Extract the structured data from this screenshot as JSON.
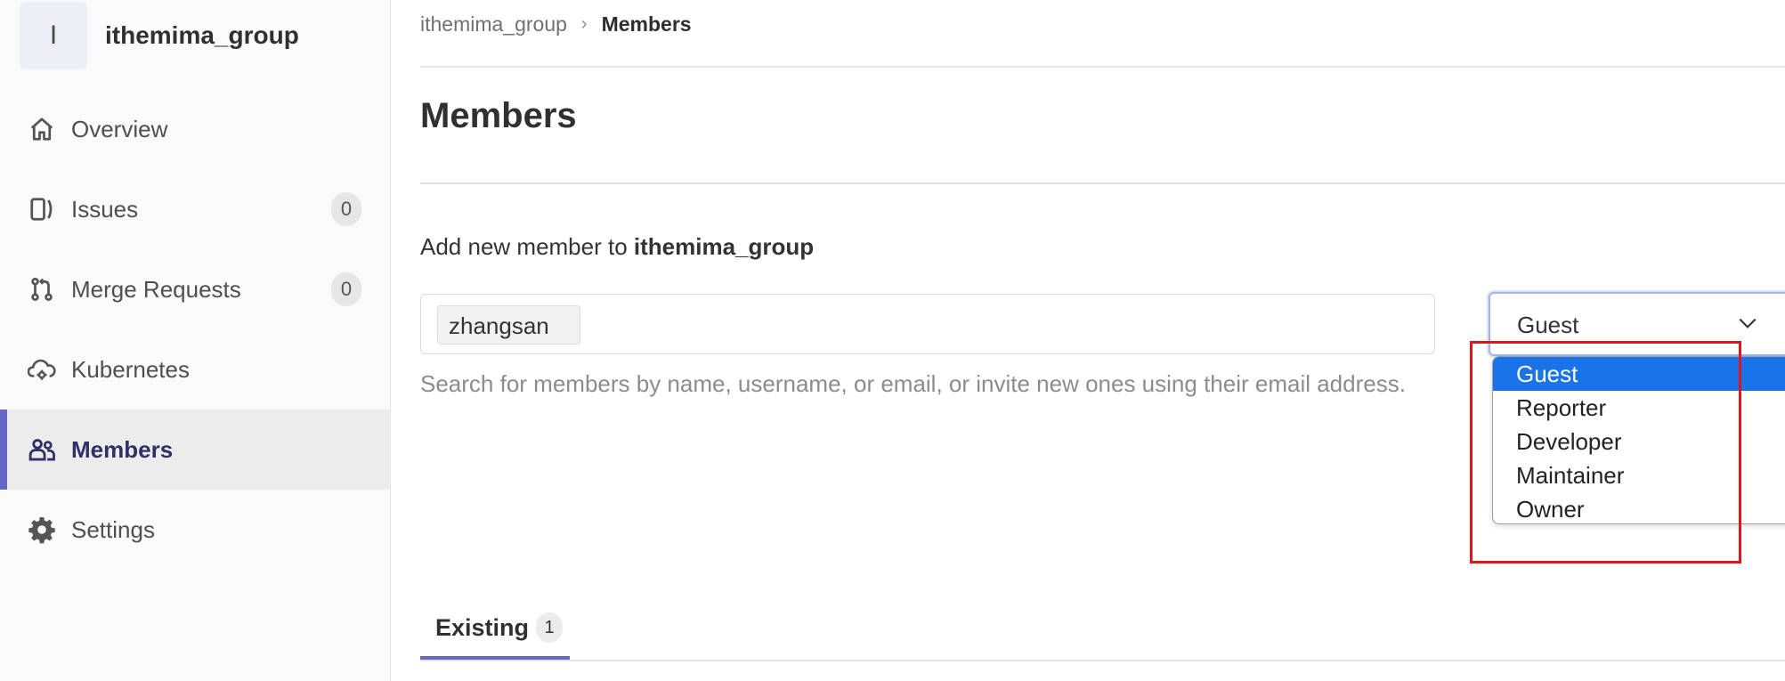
{
  "sidebar": {
    "group_initial": "I",
    "group_name": "ithemima_group",
    "items": [
      {
        "label": "Overview",
        "icon": "home-icon"
      },
      {
        "label": "Issues",
        "icon": "issues-icon",
        "count": "0"
      },
      {
        "label": "Merge Requests",
        "icon": "merge-request-icon",
        "count": "0"
      },
      {
        "label": "Kubernetes",
        "icon": "cloud-gear-icon"
      },
      {
        "label": "Members",
        "icon": "users-icon",
        "active": true
      },
      {
        "label": "Settings",
        "icon": "gear-icon"
      }
    ]
  },
  "breadcrumb": {
    "parent": "ithemima_group",
    "separator": "›",
    "current": "Members"
  },
  "page": {
    "title": "Members",
    "add_heading_prefix": "Add new member to ",
    "add_heading_group": "ithemima_group"
  },
  "search": {
    "token_value": "zhangsan",
    "help": "Search for members by name, username, or email, or invite new ones using their email address."
  },
  "role_select": {
    "selected": "Guest",
    "options": [
      "Guest",
      "Reporter",
      "Developer",
      "Maintainer",
      "Owner"
    ]
  },
  "tabs": {
    "existing_label": "Existing",
    "existing_count": "1"
  },
  "colors": {
    "accent": "#6666c4",
    "selected_option": "#1a73e8",
    "annotation_box": "#e0141c"
  }
}
